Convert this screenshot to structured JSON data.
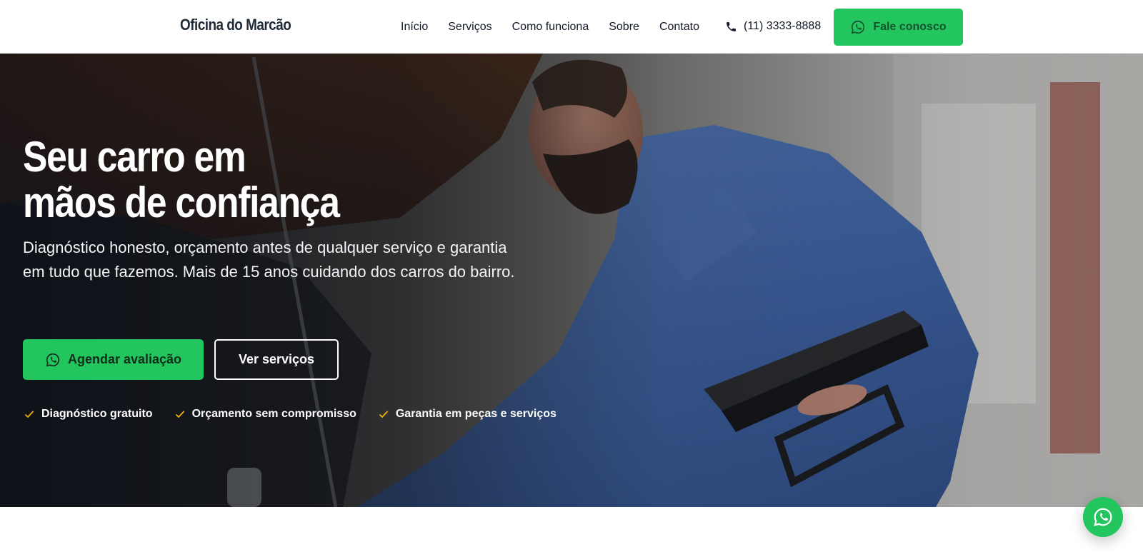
{
  "header": {
    "brand": "Oficina do Marcão",
    "nav": [
      {
        "label": "Início"
      },
      {
        "label": "Serviços"
      },
      {
        "label": "Como funciona"
      },
      {
        "label": "Sobre"
      },
      {
        "label": "Contato"
      }
    ],
    "phone": {
      "icon": "phone-icon",
      "label": "(11) 3333-8888"
    },
    "cta": {
      "icon": "whatsapp-icon",
      "label": "Fale conosco"
    }
  },
  "hero": {
    "title_line1": "Seu carro em",
    "title_line2": "mãos de confiança",
    "description": "Diagnóstico honesto, orçamento antes de qualquer serviço e garantia em tudo que fazemos. Mais de 15 anos cuidando dos carros do bairro.",
    "primary_button": {
      "icon": "whatsapp-icon",
      "label": "Agendar avaliação"
    },
    "secondary_button": {
      "label": "Ver serviços"
    },
    "badges": [
      {
        "icon": "check-icon",
        "label": "Diagnóstico gratuito"
      },
      {
        "icon": "check-icon",
        "label": "Orçamento sem compromisso"
      },
      {
        "icon": "check-icon",
        "label": "Garantia em peças e serviços"
      }
    ]
  },
  "floating_button": {
    "icon": "whatsapp-icon"
  },
  "colors": {
    "accent_green": "#22c55e",
    "check_gold": "#f5b301",
    "text_dark": "#111827"
  }
}
